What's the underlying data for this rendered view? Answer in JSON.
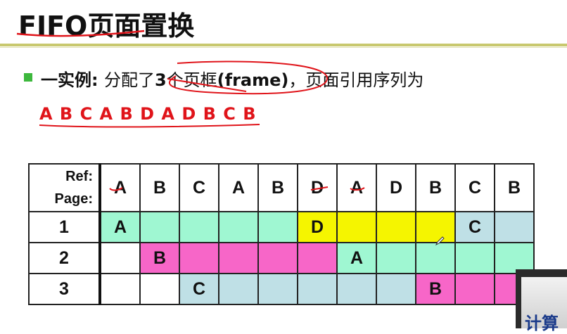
{
  "slide": {
    "title": "FIFO页面置换",
    "line1_prefix": "一实例: ",
    "line1_mid": "分配了",
    "line1_num": "3",
    "line1_ge": "个页框",
    "line1_frame": "(frame)",
    "line1_suffix": "，页面引用序列为",
    "sequence": "A B C A B D A D B C B"
  },
  "table": {
    "header_ref": "Ref:",
    "header_page": "Page:",
    "refs": [
      "A",
      "B",
      "C",
      "A",
      "B",
      "D",
      "A",
      "D",
      "B",
      "C",
      "B"
    ],
    "rows": [
      {
        "label": "1",
        "cells": [
          "A",
          "",
          "",
          "",
          "",
          "D",
          "",
          "",
          "",
          "C",
          ""
        ]
      },
      {
        "label": "2",
        "cells": [
          "",
          "B",
          "",
          "",
          "",
          "",
          "A",
          "",
          "",
          "",
          ""
        ]
      },
      {
        "label": "3",
        "cells": [
          "",
          "",
          "C",
          "",
          "",
          "",
          "",
          "",
          "B",
          "",
          ""
        ]
      }
    ]
  },
  "corner_text": "计算",
  "colors": {
    "mint": "#9ff7d2",
    "yellow": "#f5f500",
    "pink": "#f766c8",
    "blue": "#bfe0e6",
    "red": "#e0141a",
    "bullet": "#3db83d"
  }
}
